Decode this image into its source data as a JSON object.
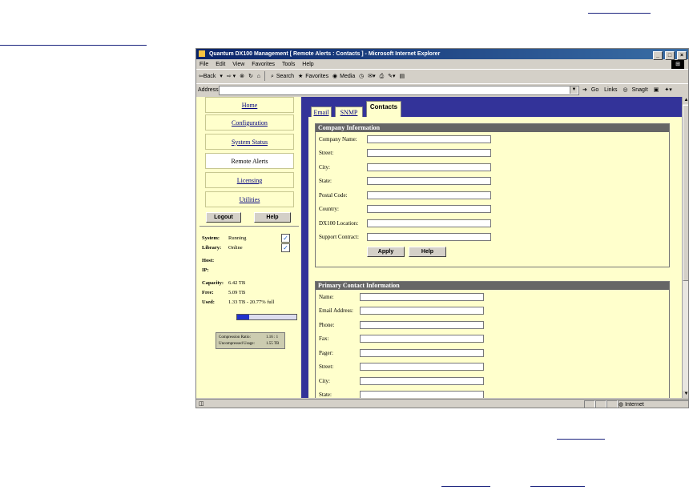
{
  "window": {
    "title": "Quantum DX100 Management [ Remote Alerts : Contacts ] - Microsoft Internet Explorer",
    "controls": [
      "_",
      "□",
      "×"
    ]
  },
  "menubar": [
    "File",
    "Edit",
    "View",
    "Favorites",
    "Tools",
    "Help"
  ],
  "toolbar": {
    "back": "⇦Back",
    "search": "Search",
    "favorites": "Favorites",
    "media": "Media"
  },
  "addressbar": {
    "label": "Address",
    "value": "",
    "go": "Go",
    "links": "Links",
    "snagit": "SnagIt"
  },
  "sidebar": {
    "items": [
      {
        "label": "Home"
      },
      {
        "label": "Configuration"
      },
      {
        "label": "System Status"
      },
      {
        "label": "Remote Alerts"
      },
      {
        "label": "Licensing"
      },
      {
        "label": "Utilities"
      }
    ],
    "logout": "Logout",
    "help": "Help",
    "status": {
      "system_label": "System:",
      "system_value": "Running",
      "library_label": "Library:",
      "library_value": "Online",
      "host_label": "Host:",
      "ip_label": "IP:",
      "capacity_label": "Capacity:",
      "capacity_value": "6.42 TB",
      "free_label": "Free:",
      "free_value": "5.09 TB",
      "used_label": "Used:",
      "used_value": "1.33 TB - 20.77% full",
      "used_fraction": 0.2077,
      "compression_label": "Compression Ratio:",
      "compression_value": "1.16 : 1",
      "uncompressed_label": "Uncompressed Usage:",
      "uncompressed_value": "1.55 TB"
    }
  },
  "tabs": [
    {
      "label": "Email"
    },
    {
      "label": "SNMP"
    },
    {
      "label": "Contacts"
    }
  ],
  "company": {
    "title": "Company Information",
    "fields": [
      "Company Name:",
      "Street:",
      "City:",
      "State:",
      "Postal Code:",
      "Country:",
      "DX100 Location:",
      "Support Contract:"
    ],
    "apply": "Apply",
    "help": "Help"
  },
  "primary": {
    "title": "Primary Contact Information",
    "fields": [
      "Name:",
      "Email Address:",
      "Phone:",
      "Fax:",
      "Pager:",
      "Street:",
      "City:",
      "State:"
    ]
  },
  "statusbar": {
    "zone": "Internet"
  },
  "colors": {
    "nav_background": "#ffffcc",
    "content_frame": "#333399",
    "group_header": "#666666",
    "titlebar": "#0a246a",
    "doc_lines": "#1a237e"
  }
}
